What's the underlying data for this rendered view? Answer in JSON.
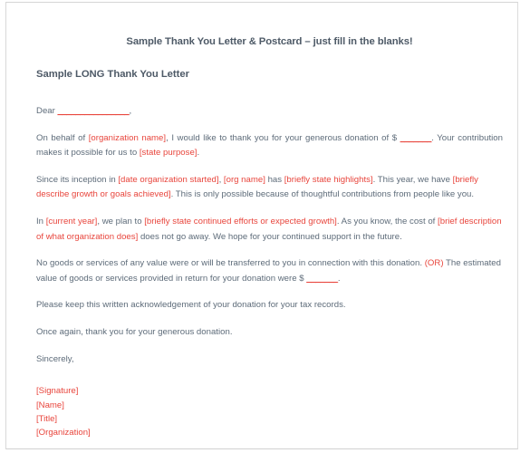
{
  "document": {
    "title": "Sample Thank You Letter & Postcard – just fill in the blanks!",
    "subtitle": "Sample LONG Thank You Letter",
    "salutation": {
      "prefix": "Dear ",
      "blank": "________________",
      "suffix": ","
    },
    "paragraphs": [
      {
        "id": "p-on-behalf",
        "segments": [
          {
            "text": "On behalf of ",
            "style": "normal"
          },
          {
            "text": "[organization name]",
            "style": "red"
          },
          {
            "text": ", I would like to thank you for your generous donation of $ ",
            "style": "normal"
          },
          {
            "text": "_______",
            "style": "blank"
          },
          {
            "text": ". Your contribution makes it possible for us to ",
            "style": "normal"
          },
          {
            "text": "[state purpose]",
            "style": "red"
          },
          {
            "text": ".",
            "style": "normal"
          }
        ]
      },
      {
        "id": "p-since-inception",
        "segments": [
          {
            "text": "Since its inception in ",
            "style": "normal"
          },
          {
            "text": "[date organization started]",
            "style": "red"
          },
          {
            "text": ", ",
            "style": "normal"
          },
          {
            "text": "[org name]",
            "style": "red"
          },
          {
            "text": " has ",
            "style": "normal"
          },
          {
            "text": "[briefly state highlights]",
            "style": "red"
          },
          {
            "text": ". This year, we have ",
            "style": "normal"
          },
          {
            "text": "[briefly describe growth or goals achieved]",
            "style": "red"
          },
          {
            "text": ". This is only possible because of thoughtful contributions from people like you.",
            "style": "normal"
          }
        ]
      },
      {
        "id": "p-current-year",
        "segments": [
          {
            "text": "In ",
            "style": "normal"
          },
          {
            "text": "[current year]",
            "style": "red"
          },
          {
            "text": ", we plan to ",
            "style": "normal"
          },
          {
            "text": "[briefly state continued efforts or expected growth]",
            "style": "red"
          },
          {
            "text": ". As you know, the cost of ",
            "style": "normal"
          },
          {
            "text": "[brief description of what organization does]",
            "style": "red"
          },
          {
            "text": " does not go away. We hope for your continued support in the future.",
            "style": "normal"
          }
        ]
      },
      {
        "id": "p-no-goods",
        "segments": [
          {
            "text": "No goods or services of any value were or will be transferred to you in connection with this donation. ",
            "style": "normal"
          },
          {
            "text": "(OR)",
            "style": "red"
          },
          {
            "text": " The estimated value of goods or services provided in return for your donation were $ ",
            "style": "normal"
          },
          {
            "text": "_______",
            "style": "blank"
          },
          {
            "text": ".",
            "style": "normal"
          }
        ]
      },
      {
        "id": "p-tax-records",
        "segments": [
          {
            "text": "Please keep this written acknowledgement of your donation for your tax records.",
            "style": "normal"
          }
        ]
      },
      {
        "id": "p-once-again",
        "segments": [
          {
            "text": "Once again, thank you for your generous donation.",
            "style": "normal"
          }
        ]
      },
      {
        "id": "p-sincerely",
        "segments": [
          {
            "text": "Sincerely,",
            "style": "normal"
          }
        ]
      }
    ],
    "signature_block": [
      "[Signature]",
      "[Name]",
      "[Title]",
      "[Organization]"
    ]
  },
  "colors": {
    "heading": "#4e5a67",
    "body_text": "#5d6b79",
    "placeholder_red": "#e8453c",
    "page_border": "#d8d8d8",
    "page_background": "#ffffff"
  }
}
